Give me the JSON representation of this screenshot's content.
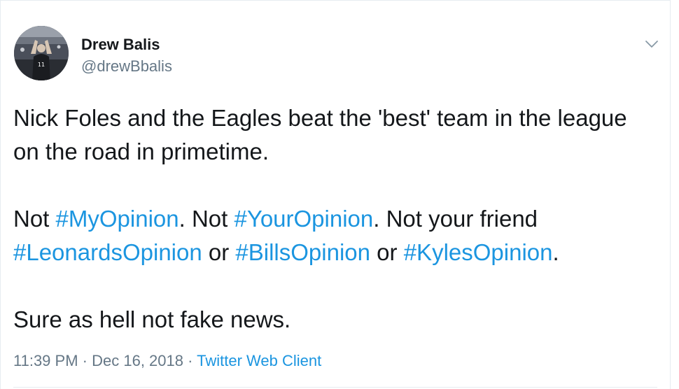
{
  "author": {
    "name": "Drew Balis",
    "handle": "@drewBbalis",
    "avatar_icon": "stadium-fan-photo"
  },
  "menu": {
    "icon": "chevron-down-icon"
  },
  "body": {
    "para1": "Nick Foles and the Eagles beat the 'best' team in the league on the road in primetime.",
    "para2": {
      "t1": "Not ",
      "tag1": "#MyOpinion",
      "t2": ". Not ",
      "tag2": "#YourOpinion",
      "t3": ". Not your friend ",
      "tag3": "#LeonardsOpinion",
      "t4": " or ",
      "tag4": "#BillsOpinion",
      "t5": " or ",
      "tag5": "#KylesOpinion",
      "t6": "."
    },
    "para3": "Sure as hell not fake news."
  },
  "meta": {
    "time": "11:39 PM",
    "sep1": " · ",
    "date": "Dec 16, 2018",
    "sep2": " · ",
    "client": "Twitter Web Client"
  },
  "colors": {
    "link": "#1b95e0",
    "secondary": "#657786",
    "text": "#14171a"
  }
}
